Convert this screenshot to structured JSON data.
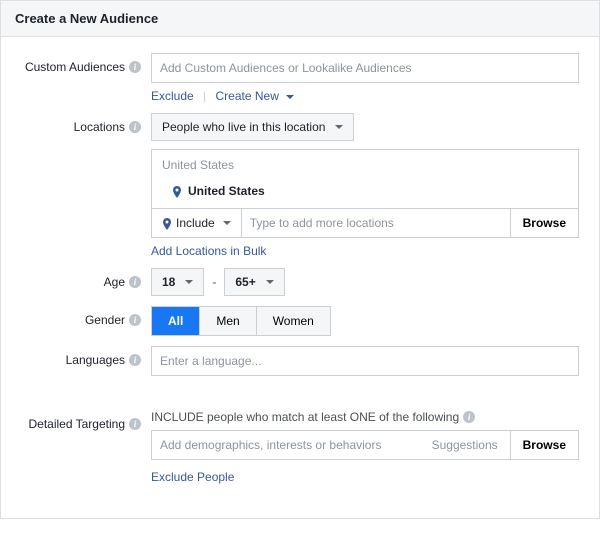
{
  "header": {
    "title": "Create a New Audience"
  },
  "customAudiences": {
    "label": "Custom Audiences",
    "placeholder": "Add Custom Audiences or Lookalike Audiences",
    "excludeLink": "Exclude",
    "createNewLink": "Create New"
  },
  "locations": {
    "label": "Locations",
    "dropdownLabel": "People who live in this location",
    "groupHeader": "United States",
    "selectedItem": "United States",
    "includeLabel": "Include",
    "inputPlaceholder": "Type to add more locations",
    "browseLabel": "Browse",
    "bulkLink": "Add Locations in Bulk"
  },
  "age": {
    "label": "Age",
    "min": "18",
    "max": "65+"
  },
  "gender": {
    "label": "Gender",
    "all": "All",
    "men": "Men",
    "women": "Women"
  },
  "languages": {
    "label": "Languages",
    "placeholder": "Enter a language..."
  },
  "detailedTargeting": {
    "label": "Detailed Targeting",
    "includeText": "INCLUDE people who match at least ONE of the following",
    "placeholder": "Add demographics, interests or behaviors",
    "suggestions": "Suggestions",
    "browse": "Browse",
    "excludeLink": "Exclude People"
  }
}
